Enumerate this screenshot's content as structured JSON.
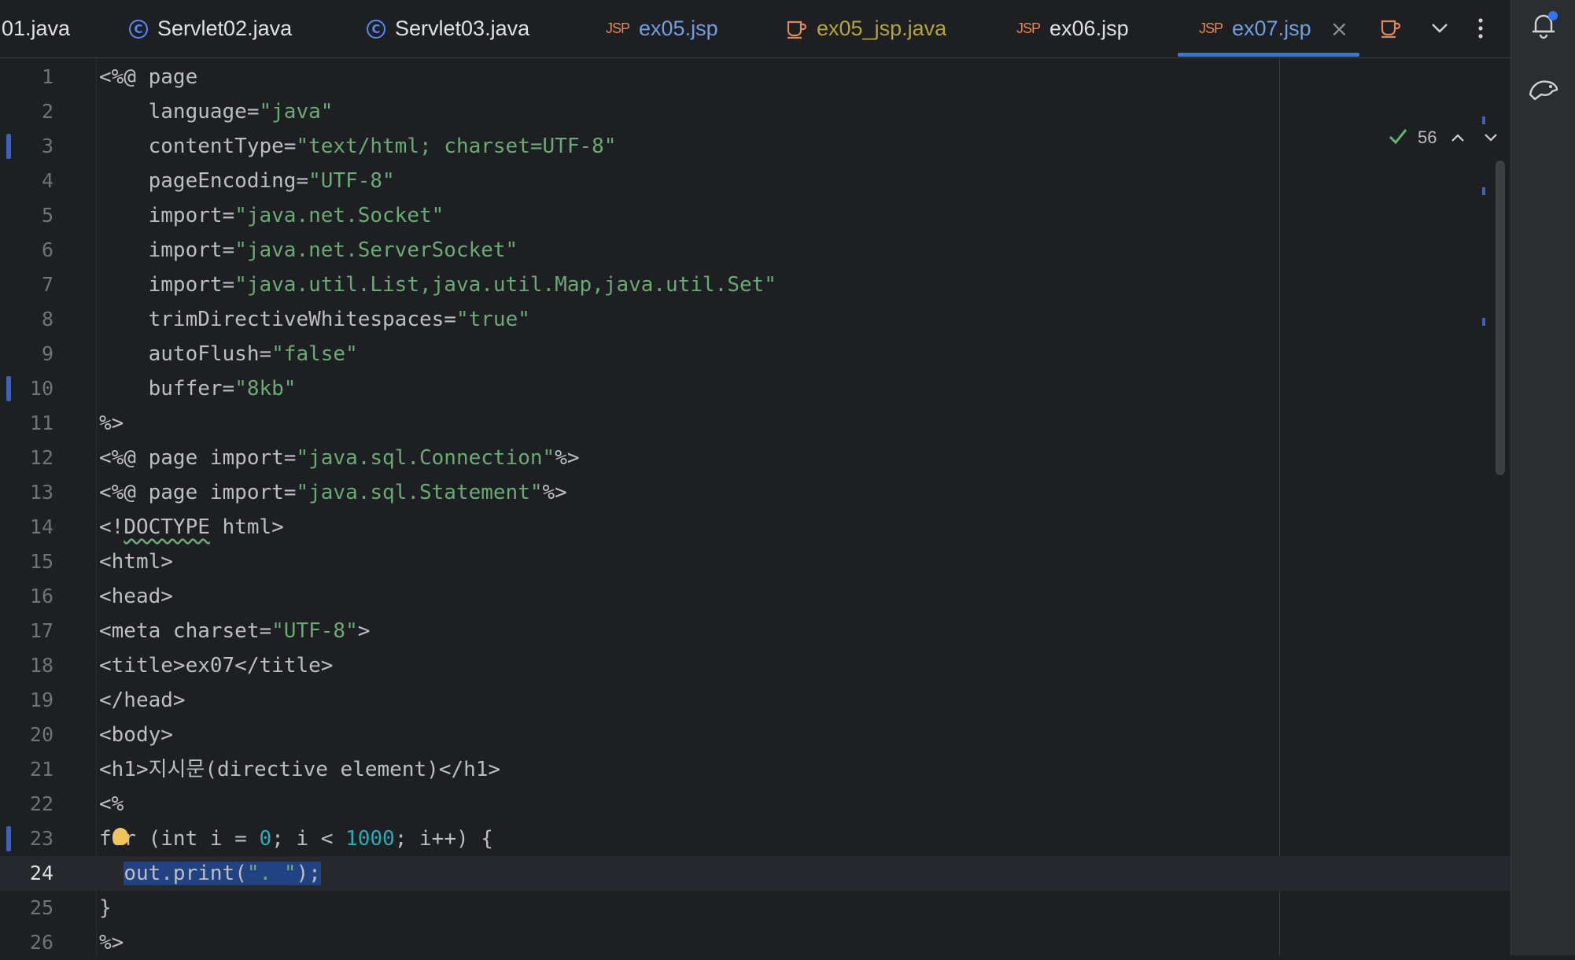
{
  "tabs": [
    {
      "label": "01.java",
      "icon": "class-icon",
      "state": "normal"
    },
    {
      "label": "Servlet02.java",
      "icon": "class-icon",
      "state": "normal"
    },
    {
      "label": "Servlet03.java",
      "icon": "class-icon",
      "state": "normal"
    },
    {
      "label": "ex05.jsp",
      "icon": "jsp-icon",
      "state": "vcs-changed"
    },
    {
      "label": "ex05_jsp.java",
      "icon": "java-cup-icon",
      "state": "modified"
    },
    {
      "label": "ex06.jsp",
      "icon": "jsp-icon",
      "state": "normal"
    },
    {
      "label": "ex07.jsp",
      "icon": "jsp-icon",
      "state": "active"
    }
  ],
  "jsp_icon_text": "JSP",
  "class_icon_text": "C",
  "tab_close_glyph": "×",
  "inspection": {
    "count": "56"
  },
  "colors": {
    "background": "#1e1f22",
    "string": "#6aab73",
    "number": "#2aacb8",
    "selection": "#214283",
    "accent": "#3574f0",
    "modified_tab": "#b3a637"
  },
  "code": {
    "lines": [
      {
        "n": "1",
        "segments": [
          {
            "t": "<%@ page"
          }
        ]
      },
      {
        "n": "2",
        "segments": [
          {
            "t": "    language="
          },
          {
            "t": "\"java\"",
            "c": "str"
          }
        ]
      },
      {
        "n": "3",
        "changed": true,
        "segments": [
          {
            "t": "    contentType="
          },
          {
            "t": "\"text/html; charset=UTF-8\"",
            "c": "str"
          }
        ]
      },
      {
        "n": "4",
        "segments": [
          {
            "t": "    pageEncoding="
          },
          {
            "t": "\"UTF-8\"",
            "c": "str"
          }
        ]
      },
      {
        "n": "5",
        "segments": [
          {
            "t": "    import="
          },
          {
            "t": "\"java.net.Socket\"",
            "c": "str"
          }
        ]
      },
      {
        "n": "6",
        "segments": [
          {
            "t": "    import="
          },
          {
            "t": "\"java.net.ServerSocket\"",
            "c": "str"
          }
        ]
      },
      {
        "n": "7",
        "segments": [
          {
            "t": "    import="
          },
          {
            "t": "\"java.util.List,java.util.Map,java.util.Set\"",
            "c": "str"
          }
        ]
      },
      {
        "n": "8",
        "segments": [
          {
            "t": "    trimDirectiveWhitespaces="
          },
          {
            "t": "\"true\"",
            "c": "str"
          }
        ]
      },
      {
        "n": "9",
        "segments": [
          {
            "t": "    autoFlush="
          },
          {
            "t": "\"false\"",
            "c": "str"
          }
        ]
      },
      {
        "n": "10",
        "changed": true,
        "segments": [
          {
            "t": "    buffer="
          },
          {
            "t": "\"8kb\"",
            "c": "str"
          }
        ]
      },
      {
        "n": "11",
        "segments": [
          {
            "t": "%>"
          }
        ]
      },
      {
        "n": "12",
        "segments": [
          {
            "t": "<%@ page import="
          },
          {
            "t": "\"java.sql.Connection\"",
            "c": "str"
          },
          {
            "t": "%>"
          }
        ]
      },
      {
        "n": "13",
        "segments": [
          {
            "t": "<%@ page import="
          },
          {
            "t": "\"java.sql.Statement\"",
            "c": "str"
          },
          {
            "t": "%>"
          }
        ]
      },
      {
        "n": "14",
        "segments": [
          {
            "t": "<!"
          },
          {
            "t": "DOCTYPE",
            "c": "squig"
          },
          {
            "t": " html>"
          }
        ]
      },
      {
        "n": "15",
        "segments": [
          {
            "t": "<html>"
          }
        ]
      },
      {
        "n": "16",
        "segments": [
          {
            "t": "<head>"
          }
        ]
      },
      {
        "n": "17",
        "segments": [
          {
            "t": "<meta charset="
          },
          {
            "t": "\"UTF-8\"",
            "c": "str"
          },
          {
            "t": ">"
          }
        ]
      },
      {
        "n": "18",
        "segments": [
          {
            "t": "<title>ex07</title>"
          }
        ]
      },
      {
        "n": "19",
        "segments": [
          {
            "t": "</head>"
          }
        ]
      },
      {
        "n": "20",
        "segments": [
          {
            "t": "<body>"
          }
        ]
      },
      {
        "n": "21",
        "segments": [
          {
            "t": "<h1>지시문(directive element)</h1>"
          }
        ]
      },
      {
        "n": "22",
        "segments": [
          {
            "t": "<%"
          }
        ]
      },
      {
        "n": "23",
        "changed": true,
        "bulb": true,
        "segments": [
          {
            "t": "for (int i = "
          },
          {
            "t": "0",
            "c": "num"
          },
          {
            "t": "; i < "
          },
          {
            "t": "1000",
            "c": "num"
          },
          {
            "t": "; i++) {"
          }
        ]
      },
      {
        "n": "24",
        "current": true,
        "segments": [
          {
            "t": "  "
          },
          {
            "t": "out.print(",
            "c": "sel"
          },
          {
            "t": "\". \"",
            "c": "sel str"
          },
          {
            "t": ");",
            "c": "sel"
          }
        ]
      },
      {
        "n": "25",
        "segments": [
          {
            "t": "}"
          }
        ]
      },
      {
        "n": "26",
        "segments": [
          {
            "t": "%>"
          }
        ]
      }
    ]
  }
}
